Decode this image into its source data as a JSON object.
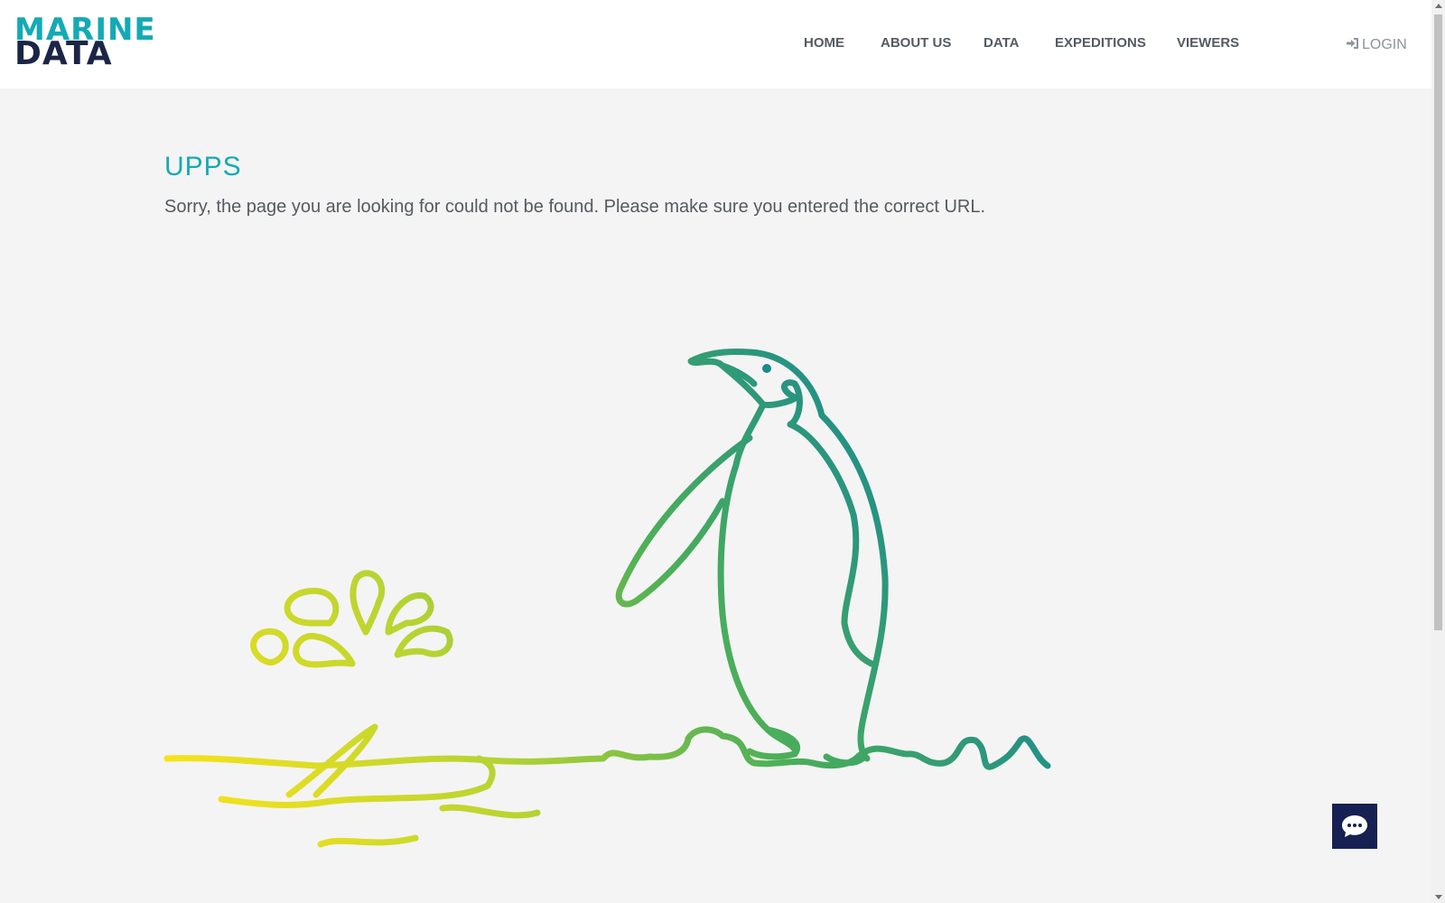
{
  "header": {
    "logo": {
      "line1": "MARINE",
      "line2": "DATA"
    },
    "nav": [
      {
        "label": "HOME"
      },
      {
        "label": "ABOUT US"
      },
      {
        "label": "DATA"
      },
      {
        "label": "EXPEDITIONS"
      },
      {
        "label": "VIEWERS"
      }
    ],
    "login_label": "LOGIN",
    "login_icon": "sign-in-icon"
  },
  "main": {
    "title": "UPPS",
    "message": "Sorry, the page you are looking for could not be found. Please make sure you entered the correct URL.",
    "illustration": "penguin-icon"
  },
  "chat": {
    "icon": "chat-bubble-icon"
  },
  "colors": {
    "accent": "#14aab5",
    "brand_dark": "#1b2546",
    "chat_button": "#162052",
    "illustration_start": "#f7e21a",
    "illustration_end": "#1a8a8f"
  }
}
